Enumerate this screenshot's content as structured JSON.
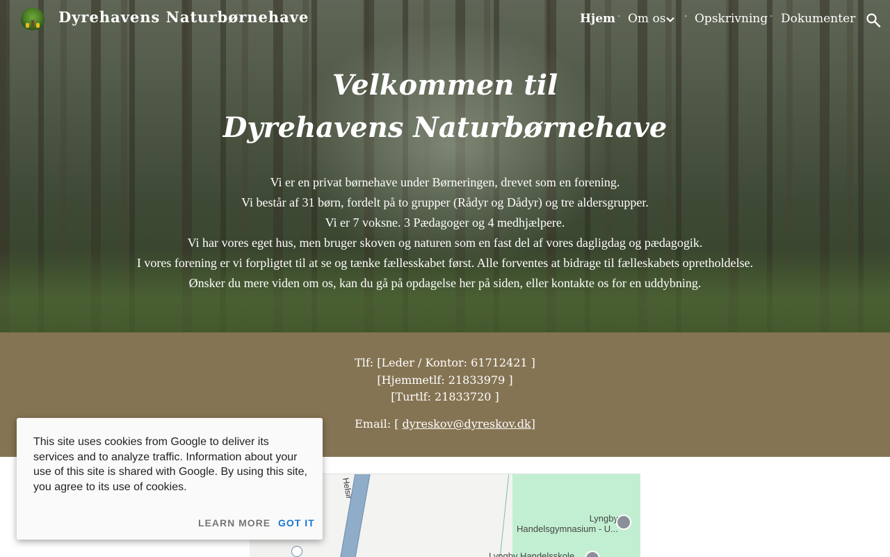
{
  "header": {
    "site_title": "Dyrehavens Naturbørnehave",
    "logo_icon": "tree-logo-icon",
    "nav": [
      {
        "label": "Hjem",
        "active": true
      },
      {
        "label": "Om os",
        "has_dropdown": true
      },
      {
        "label": "Opskrivning"
      },
      {
        "label": "Dokumenter"
      }
    ],
    "separator": "·",
    "search_icon": "search-icon"
  },
  "hero": {
    "title_line1": "Velkommen til",
    "title_line2": "Dyrehavens Naturbørnehave",
    "paragraphs": [
      "Vi er en privat børnehave under Børneringen, drevet som en forening.",
      "Vi består af 31 børn, fordelt på to grupper (Rådyr og Dådyr)  og tre aldersgrupper.",
      "Vi er 7 voksne. 3 Pædagoger og 4 medhjælpere.",
      "Vi har vores eget hus, men bruger skoven og naturen som en fast del af vores dagligdag og pædagogik.",
      "I vores forening er vi forpligtet til at se og tænke fællesskabet først. Alle forventes at bidrage til fælleskabets opretholdelse.",
      "Ønsker du mere viden om os, kan du gå på opdagelse her på siden, eller kontakte os for en uddybning."
    ]
  },
  "contact": {
    "phone_lines": [
      "Tlf: [Leder / Kontor: 61712421 ]",
      "[Hjemmetlf: 21833979  ]",
      "[Turtlf: 21833720 ]"
    ],
    "email_prefix": "Email: [ ",
    "email": "dyreskov@dyreskov.dk",
    "email_suffix": "]"
  },
  "map": {
    "road_label": "Helsir",
    "poi1_line1": "Lyngby",
    "poi1_line2": "Handelsgymnasium - U...",
    "poi2": "Lyngby Handelsskole"
  },
  "cookie": {
    "message": "This site uses cookies from Google to deliver its services and to analyze traffic. Information about your use of this site is shared with Google. By using this site, you agree to its use of cookies.",
    "learn_more": "LEARN MORE",
    "got_it": "GOT IT"
  },
  "colors": {
    "contact_band": "#857453",
    "got_it": "#1976d2",
    "learn_more": "#757575"
  }
}
